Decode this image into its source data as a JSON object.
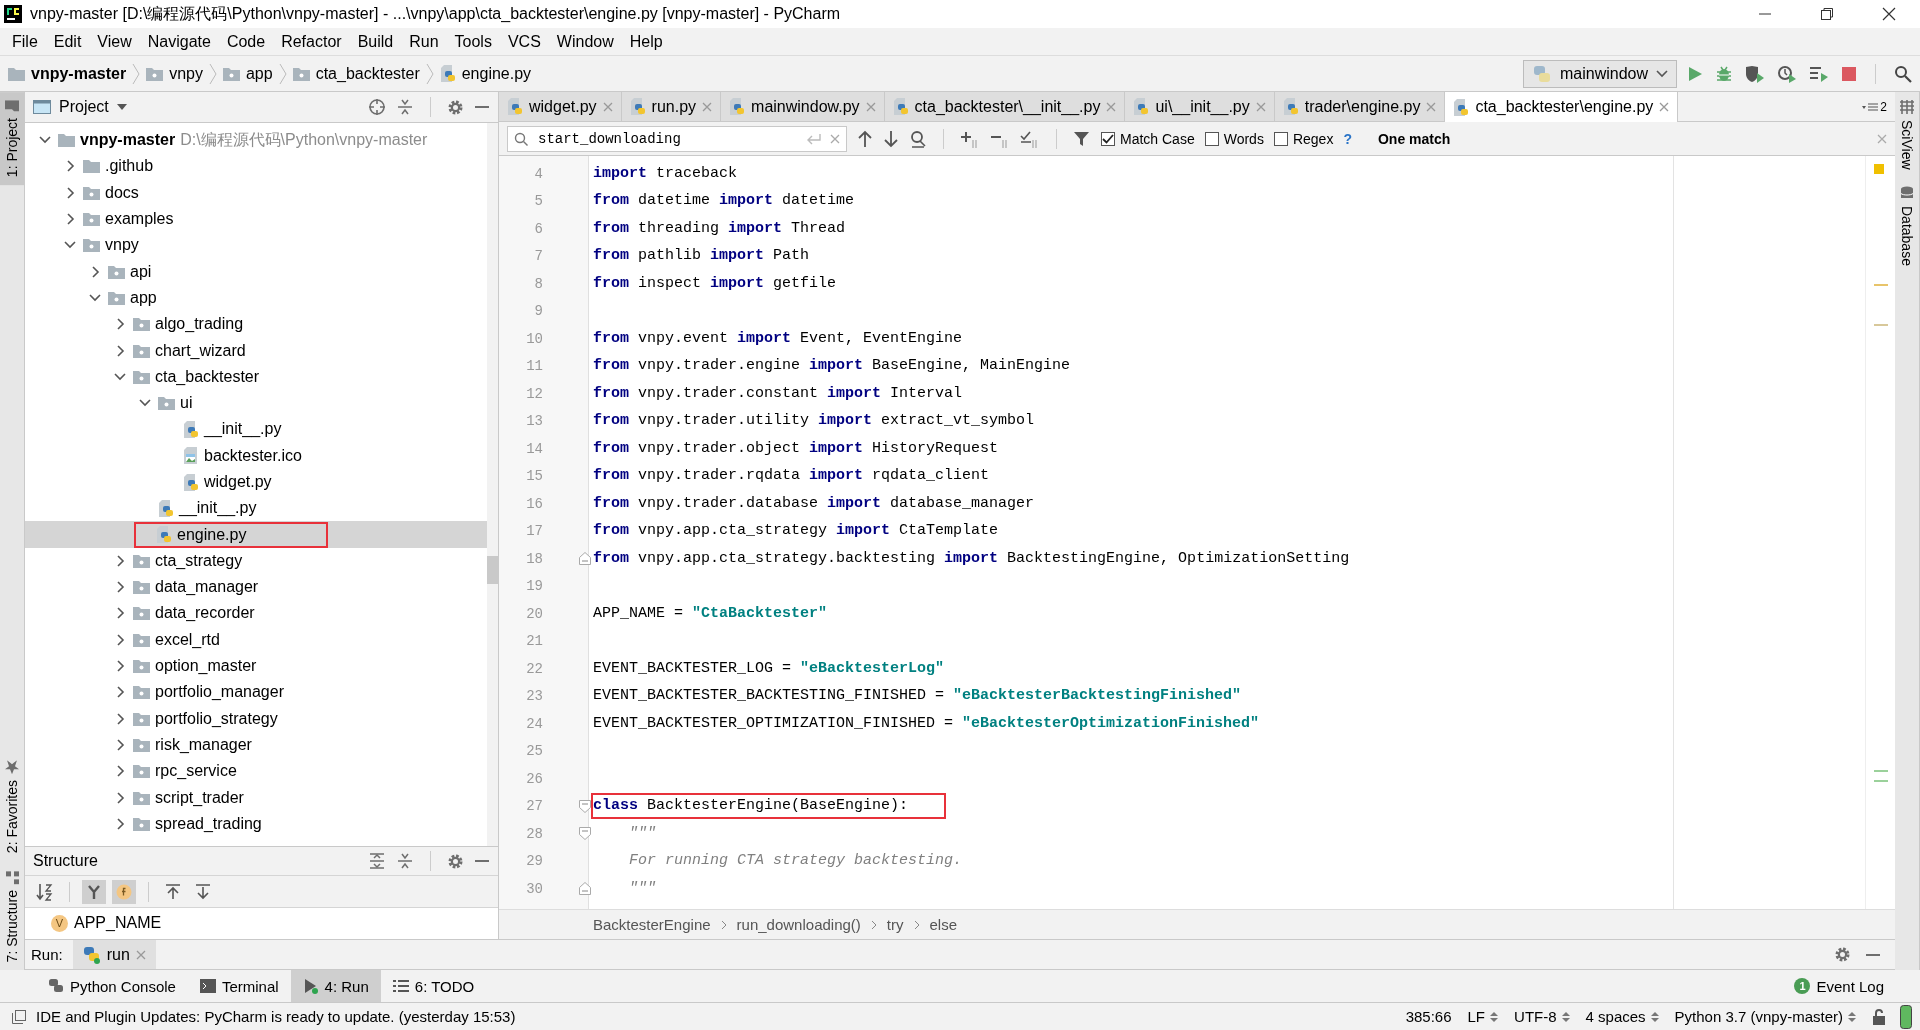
{
  "window": {
    "title": "vnpy-master [D:\\编程源代码\\Python\\vnpy-master] - ...\\vnpy\\app\\cta_backtester\\engine.py [vnpy-master] - PyCharm"
  },
  "menu": [
    "File",
    "Edit",
    "View",
    "Navigate",
    "Code",
    "Refactor",
    "Build",
    "Run",
    "Tools",
    "VCS",
    "Window",
    "Help"
  ],
  "nav_path": [
    {
      "label": "vnpy-master",
      "kind": "folder"
    },
    {
      "label": "vnpy",
      "kind": "package"
    },
    {
      "label": "app",
      "kind": "package"
    },
    {
      "label": "cta_backtester",
      "kind": "package"
    },
    {
      "label": "engine.py",
      "kind": "python"
    }
  ],
  "run_config": {
    "label": "mainwindow"
  },
  "left_strip": [
    {
      "label": "1: Project",
      "selected": true
    },
    {
      "label": "2: Favorites",
      "selected": false
    },
    {
      "label": "7: Structure",
      "selected": false
    }
  ],
  "right_strip": [
    {
      "label": "SciView"
    },
    {
      "label": "Database"
    }
  ],
  "project": {
    "title": "Project",
    "tree": [
      {
        "label": "vnpy-master",
        "hint": "D:\\编程源代码\\Python\\vnpy-master",
        "kind": "folder",
        "expanded": true,
        "selected": false,
        "highlighted": false,
        "children": [
          {
            "label": ".github",
            "kind": "folder",
            "expanded": false,
            "selected": false,
            "highlighted": false
          },
          {
            "label": "docs",
            "kind": "package",
            "expanded": false,
            "selected": false,
            "highlighted": false
          },
          {
            "label": "examples",
            "kind": "package",
            "expanded": false,
            "selected": false,
            "highlighted": false
          },
          {
            "label": "vnpy",
            "kind": "package",
            "expanded": true,
            "selected": false,
            "highlighted": false,
            "children": [
              {
                "label": "api",
                "kind": "package",
                "expanded": false,
                "selected": false,
                "highlighted": false
              },
              {
                "label": "app",
                "kind": "package",
                "expanded": true,
                "selected": false,
                "highlighted": false,
                "children": [
                  {
                    "label": "algo_trading",
                    "kind": "package",
                    "expanded": false,
                    "selected": false,
                    "highlighted": false
                  },
                  {
                    "label": "chart_wizard",
                    "kind": "package",
                    "expanded": false,
                    "selected": false,
                    "highlighted": false
                  },
                  {
                    "label": "cta_backtester",
                    "kind": "package",
                    "expanded": true,
                    "selected": false,
                    "highlighted": false,
                    "children": [
                      {
                        "label": "ui",
                        "kind": "package",
                        "expanded": true,
                        "selected": false,
                        "highlighted": false,
                        "children": [
                          {
                            "label": "__init__.py",
                            "kind": "python",
                            "selected": false,
                            "highlighted": false
                          },
                          {
                            "label": "backtester.ico",
                            "kind": "image",
                            "selected": false,
                            "highlighted": false
                          },
                          {
                            "label": "widget.py",
                            "kind": "python",
                            "selected": false,
                            "highlighted": false
                          }
                        ]
                      },
                      {
                        "label": "__init__.py",
                        "kind": "python",
                        "selected": false,
                        "highlighted": false
                      },
                      {
                        "label": "engine.py",
                        "kind": "python",
                        "selected": true,
                        "highlighted": true
                      }
                    ]
                  },
                  {
                    "label": "cta_strategy",
                    "kind": "package",
                    "expanded": false,
                    "selected": false,
                    "highlighted": false
                  },
                  {
                    "label": "data_manager",
                    "kind": "package",
                    "expanded": false,
                    "selected": false,
                    "highlighted": false
                  },
                  {
                    "label": "data_recorder",
                    "kind": "package",
                    "expanded": false,
                    "selected": false,
                    "highlighted": false
                  },
                  {
                    "label": "excel_rtd",
                    "kind": "package",
                    "expanded": false,
                    "selected": false,
                    "highlighted": false
                  },
                  {
                    "label": "option_master",
                    "kind": "package",
                    "expanded": false,
                    "selected": false,
                    "highlighted": false
                  },
                  {
                    "label": "portfolio_manager",
                    "kind": "package",
                    "expanded": false,
                    "selected": false,
                    "highlighted": false
                  },
                  {
                    "label": "portfolio_strategy",
                    "kind": "package",
                    "expanded": false,
                    "selected": false,
                    "highlighted": false
                  },
                  {
                    "label": "risk_manager",
                    "kind": "package",
                    "expanded": false,
                    "selected": false,
                    "highlighted": false
                  },
                  {
                    "label": "rpc_service",
                    "kind": "package",
                    "expanded": false,
                    "selected": false,
                    "highlighted": false
                  },
                  {
                    "label": "script_trader",
                    "kind": "package",
                    "expanded": false,
                    "selected": false,
                    "highlighted": false
                  },
                  {
                    "label": "spread_trading",
                    "kind": "package",
                    "expanded": false,
                    "selected": false,
                    "highlighted": false
                  }
                ]
              }
            ]
          }
        ]
      }
    ]
  },
  "structure": {
    "title": "Structure",
    "toolbar": [
      {
        "kind": "sort",
        "pressed": false
      },
      {
        "kind": "inherited",
        "pressed": true
      },
      {
        "kind": "fields",
        "pressed": true
      },
      {
        "kind": "expand",
        "pressed": false
      },
      {
        "kind": "collapse",
        "pressed": false
      }
    ],
    "items": [
      {
        "badge": "V",
        "label": "APP_NAME"
      }
    ]
  },
  "editor": {
    "tabs": [
      {
        "label": "widget.py",
        "selected": false
      },
      {
        "label": "run.py",
        "selected": false
      },
      {
        "label": "mainwindow.py",
        "selected": false
      },
      {
        "label": "cta_backtester\\__init__.py",
        "selected": false
      },
      {
        "label": "ui\\__init__.py",
        "selected": false
      },
      {
        "label": "trader\\engine.py",
        "selected": false
      },
      {
        "label": "cta_backtester\\engine.py",
        "selected": true
      }
    ],
    "hidden_tabs": "2",
    "search": {
      "value": "start_downloading",
      "options": [
        {
          "label": "Match Case",
          "checked": true
        },
        {
          "label": "Words",
          "checked": false
        },
        {
          "label": "Regex",
          "checked": false
        }
      ],
      "help": "?",
      "result": "One match"
    },
    "lines": [
      {
        "number": "4",
        "fold_start": false,
        "fold_end": false,
        "segments": [
          {
            "kind": "keyword",
            "text": "import"
          },
          {
            "kind": "plain",
            "text": " traceback"
          }
        ]
      },
      {
        "number": "5",
        "fold_start": false,
        "fold_end": false,
        "segments": [
          {
            "kind": "keyword",
            "text": "from"
          },
          {
            "kind": "plain",
            "text": " datetime "
          },
          {
            "kind": "keyword",
            "text": "import"
          },
          {
            "kind": "plain",
            "text": " datetime"
          }
        ]
      },
      {
        "number": "6",
        "fold_start": false,
        "fold_end": false,
        "segments": [
          {
            "kind": "keyword",
            "text": "from"
          },
          {
            "kind": "plain",
            "text": " threading "
          },
          {
            "kind": "keyword",
            "text": "import"
          },
          {
            "kind": "plain",
            "text": " Thread"
          }
        ]
      },
      {
        "number": "7",
        "fold_start": false,
        "fold_end": false,
        "segments": [
          {
            "kind": "keyword",
            "text": "from"
          },
          {
            "kind": "plain",
            "text": " pathlib "
          },
          {
            "kind": "keyword",
            "text": "import"
          },
          {
            "kind": "plain",
            "text": " Path"
          }
        ]
      },
      {
        "number": "8",
        "fold_start": false,
        "fold_end": false,
        "segments": [
          {
            "kind": "keyword",
            "text": "from"
          },
          {
            "kind": "plain",
            "text": " inspect "
          },
          {
            "kind": "keyword",
            "text": "import"
          },
          {
            "kind": "plain",
            "text": " getfile"
          }
        ]
      },
      {
        "number": "9",
        "fold_start": false,
        "fold_end": false
      },
      {
        "number": "10",
        "fold_start": false,
        "fold_end": false,
        "segments": [
          {
            "kind": "keyword",
            "text": "from"
          },
          {
            "kind": "plain",
            "text": " vnpy.event "
          },
          {
            "kind": "keyword",
            "text": "import"
          },
          {
            "kind": "plain",
            "text": " Event, EventEngine"
          }
        ]
      },
      {
        "number": "11",
        "fold_start": false,
        "fold_end": false,
        "segments": [
          {
            "kind": "keyword",
            "text": "from"
          },
          {
            "kind": "plain",
            "text": " vnpy.trader.engine "
          },
          {
            "kind": "keyword",
            "text": "import"
          },
          {
            "kind": "plain",
            "text": " BaseEngine, MainEngine"
          }
        ]
      },
      {
        "number": "12",
        "fold_start": false,
        "fold_end": false,
        "segments": [
          {
            "kind": "keyword",
            "text": "from"
          },
          {
            "kind": "plain",
            "text": " vnpy.trader.constant "
          },
          {
            "kind": "keyword",
            "text": "import"
          },
          {
            "kind": "plain",
            "text": " Interval"
          }
        ]
      },
      {
        "number": "13",
        "fold_start": false,
        "fold_end": false,
        "segments": [
          {
            "kind": "keyword",
            "text": "from"
          },
          {
            "kind": "plain",
            "text": " vnpy.trader.utility "
          },
          {
            "kind": "keyword",
            "text": "import"
          },
          {
            "kind": "plain",
            "text": " extract_vt_symbol"
          }
        ]
      },
      {
        "number": "14",
        "fold_start": false,
        "fold_end": false,
        "segments": [
          {
            "kind": "keyword",
            "text": "from"
          },
          {
            "kind": "plain",
            "text": " vnpy.trader.object "
          },
          {
            "kind": "keyword",
            "text": "import"
          },
          {
            "kind": "plain",
            "text": " HistoryRequest"
          }
        ]
      },
      {
        "number": "15",
        "fold_start": false,
        "fold_end": false,
        "segments": [
          {
            "kind": "keyword",
            "text": "from"
          },
          {
            "kind": "plain",
            "text": " vnpy.trader.rqdata "
          },
          {
            "kind": "keyword",
            "text": "import"
          },
          {
            "kind": "plain",
            "text": " rqdata_client"
          }
        ]
      },
      {
        "number": "16",
        "fold_start": false,
        "fold_end": false,
        "segments": [
          {
            "kind": "keyword",
            "text": "from"
          },
          {
            "kind": "plain",
            "text": " vnpy.trader.database "
          },
          {
            "kind": "keyword",
            "text": "import"
          },
          {
            "kind": "plain",
            "text": " database_manager"
          }
        ]
      },
      {
        "number": "17",
        "fold_start": false,
        "fold_end": false,
        "segments": [
          {
            "kind": "keyword",
            "text": "from"
          },
          {
            "kind": "plain",
            "text": " vnpy.app.cta_strategy "
          },
          {
            "kind": "keyword",
            "text": "import"
          },
          {
            "kind": "plain",
            "text": " CtaTemplate"
          }
        ]
      },
      {
        "number": "18",
        "fold_start": false,
        "fold_end": true,
        "segments": [
          {
            "kind": "keyword",
            "text": "from"
          },
          {
            "kind": "plain",
            "text": " vnpy.app.cta_strategy.backtesting "
          },
          {
            "kind": "keyword",
            "text": "import"
          },
          {
            "kind": "plain",
            "text": " BacktestingEngine, OptimizationSetting"
          }
        ]
      },
      {
        "number": "19",
        "fold_start": false,
        "fold_end": false
      },
      {
        "number": "20",
        "fold_start": false,
        "fold_end": false,
        "segments": [
          {
            "kind": "plain",
            "text": "APP_NAME = "
          },
          {
            "kind": "string",
            "text": "\"CtaBacktester\""
          }
        ]
      },
      {
        "number": "21",
        "fold_start": false,
        "fold_end": false
      },
      {
        "number": "22",
        "fold_start": false,
        "fold_end": false,
        "segments": [
          {
            "kind": "plain",
            "text": "EVENT_BACKTESTER_LOG = "
          },
          {
            "kind": "string",
            "text": "\"eBacktesterLog\""
          }
        ]
      },
      {
        "number": "23",
        "fold_start": false,
        "fold_end": false,
        "segments": [
          {
            "kind": "plain",
            "text": "EVENT_BACKTESTER_BACKTESTING_FINISHED = "
          },
          {
            "kind": "string",
            "text": "\"eBacktesterBacktestingFinished\""
          }
        ]
      },
      {
        "number": "24",
        "fold_start": false,
        "fold_end": false,
        "segments": [
          {
            "kind": "plain",
            "text": "EVENT_BACKTESTER_OPTIMIZATION_FINISHED = "
          },
          {
            "kind": "string",
            "text": "\"eBacktesterOptimizationFinished\""
          }
        ]
      },
      {
        "number": "25",
        "fold_start": false,
        "fold_end": false
      },
      {
        "number": "26",
        "fold_start": false,
        "fold_end": false
      },
      {
        "number": "27",
        "fold_start": true,
        "fold_end": false,
        "highlighted": true,
        "segments": [
          {
            "kind": "keyword",
            "text": "class"
          },
          {
            "kind": "plain",
            "text": " BacktesterEngine(BaseEngine):"
          }
        ]
      },
      {
        "number": "28",
        "fold_start": true,
        "fold_end": false,
        "segments": [
          {
            "kind": "doc",
            "text": "    \"\"\""
          }
        ]
      },
      {
        "number": "29",
        "fold_start": false,
        "fold_end": false,
        "segments": [
          {
            "kind": "doc",
            "text": "    For running CTA strategy backtesting."
          }
        ]
      },
      {
        "number": "30",
        "fold_start": false,
        "fold_end": true,
        "segments": [
          {
            "kind": "doc",
            "text": "    \"\"\""
          }
        ]
      }
    ],
    "breadcrumb": [
      "BacktesterEngine",
      "run_downloading()",
      "try",
      "else"
    ]
  },
  "run_bar": {
    "label": "Run:",
    "tabs": [
      {
        "label": "run",
        "selected": true
      }
    ]
  },
  "tool_tabs": [
    {
      "label": "Python Console",
      "kind": "python",
      "selected": false
    },
    {
      "label": "Terminal",
      "kind": "terminal",
      "selected": false
    },
    {
      "label": "4: Run",
      "kind": "run",
      "selected": true
    },
    {
      "label": "6: TODO",
      "kind": "todo",
      "selected": false
    }
  ],
  "event_log": {
    "label": "Event Log",
    "count": "1"
  },
  "status_bar": {
    "message": "IDE and Plugin Updates: PyCharm is ready to update. (yesterday 15:53)",
    "items": [
      {
        "label": "385:66",
        "dropdown": false
      },
      {
        "label": "LF",
        "dropdown": true
      },
      {
        "label": "UTF-8",
        "dropdown": true
      },
      {
        "label": "4 spaces",
        "dropdown": true
      },
      {
        "label": "Python 3.7 (vnpy-master)",
        "dropdown": true
      }
    ]
  }
}
